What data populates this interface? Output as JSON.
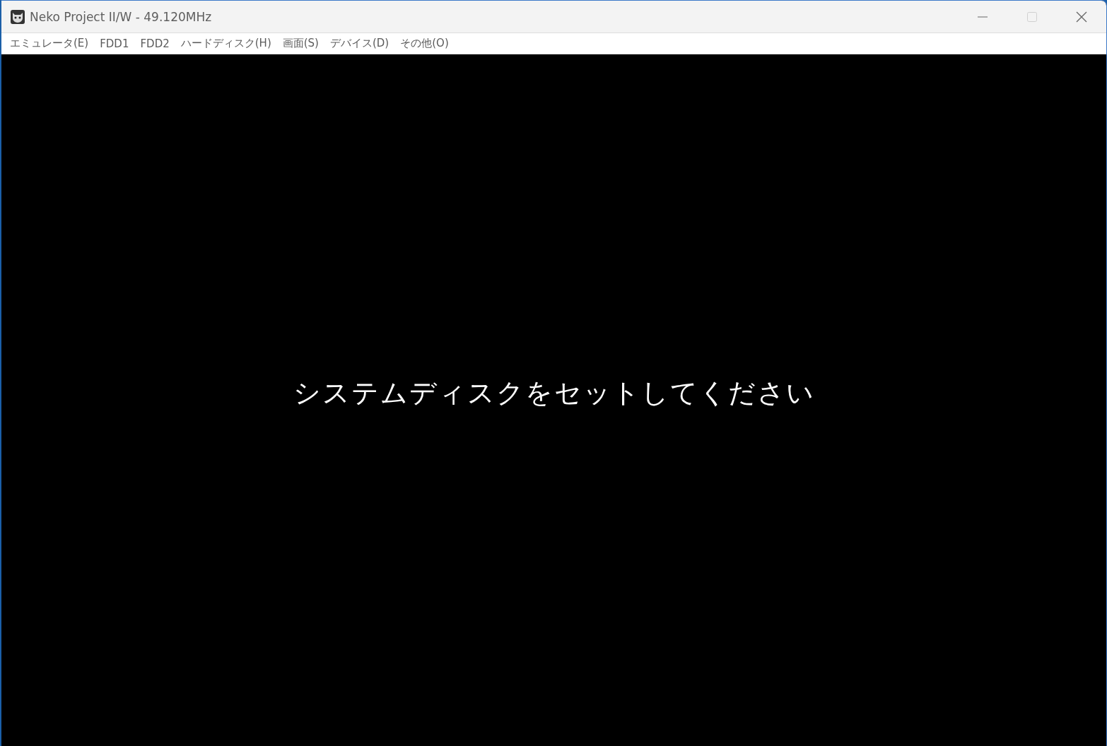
{
  "window": {
    "title": "Neko Project II/W - 49.120MHz",
    "maximize_disabled": true
  },
  "menu": [
    "エミュレータ(E)",
    "FDD1",
    "FDD2",
    "ハードディスク(H)",
    "画面(S)",
    "デバイス(D)",
    "その他(O)"
  ],
  "screen": {
    "message": "システムディスクをセットしてください"
  }
}
